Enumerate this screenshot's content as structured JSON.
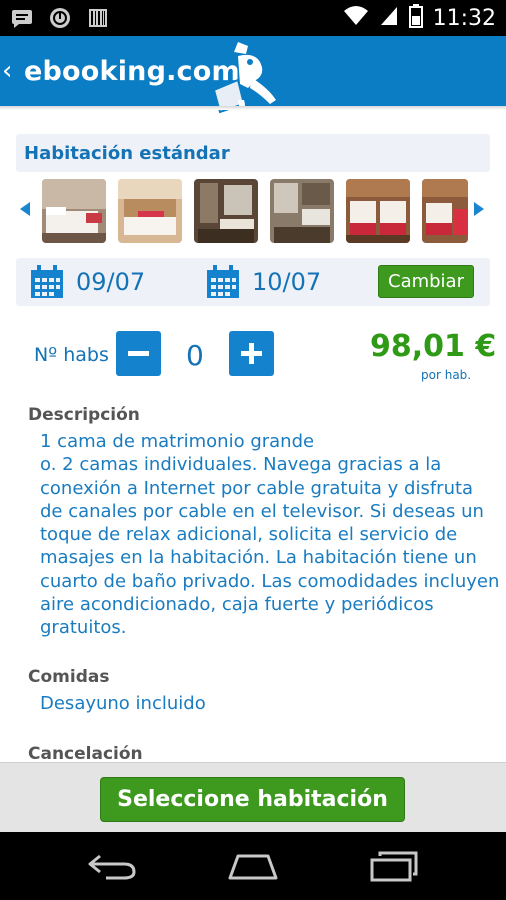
{
  "status_bar": {
    "time": "11:32",
    "icons": [
      "chat-icon",
      "clock-icon",
      "barcode-icon",
      "wifi-icon",
      "signal-icon",
      "battery-icon"
    ]
  },
  "app_bar": {
    "back_icon": "chevron-left-icon",
    "title": "ebooking.com",
    "logo": "ebooking-mascot-logo",
    "color": "#0a7dc4"
  },
  "room": {
    "title": "Habitación estándar",
    "photos": [
      "room-photo-1",
      "room-photo-2",
      "room-photo-3",
      "room-photo-4",
      "room-photo-5",
      "room-photo-6"
    ]
  },
  "dates": {
    "checkin": "09/07",
    "checkout": "10/07",
    "change_label": "Cambiar"
  },
  "rooms_selector": {
    "label": "Nº habs",
    "count": "0",
    "price": "98,01 €",
    "price_unit": "por hab."
  },
  "description": {
    "heading": "Descripción",
    "text": "1 cama de matrimonio grande\no. 2 camas individuales. Navega gracias a la conexión a Internet por cable gratuita y disfruta de canales por cable en el televisor. Si deseas un toque de relax adicional, solicita el servicio de masajes en la habitación. La habitación tiene un cuarto de baño privado. Las comodidades incluyen aire acondicionado, caja fuerte y periódicos gratuitos."
  },
  "meals": {
    "heading": "Comidas",
    "text": "Desayuno incluido"
  },
  "cancellation": {
    "heading": "Cancelación"
  },
  "footer": {
    "select_label": "Seleccione habitación",
    "accent": "#3e9a1f"
  },
  "nav_bar": {
    "icons": [
      "back-icon",
      "home-icon",
      "recents-icon"
    ]
  }
}
